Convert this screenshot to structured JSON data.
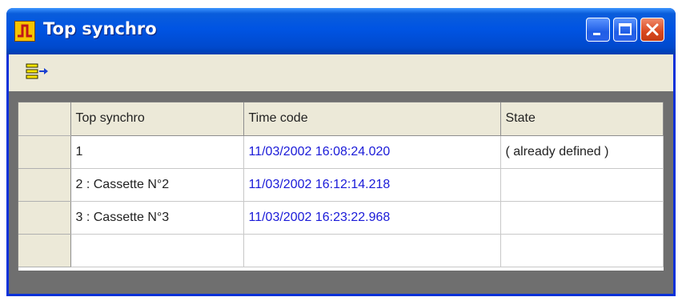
{
  "window": {
    "title": "Top synchro"
  },
  "toolbar": {
    "icons": [
      "export-icon"
    ]
  },
  "grid": {
    "columns": [
      "Top synchro",
      "Time code",
      "State"
    ],
    "rows": [
      {
        "top": "1",
        "timecode": "11/03/2002 16:08:24.020",
        "state": "( already defined )"
      },
      {
        "top": "2 : Cassette N°2",
        "timecode": "11/03/2002 16:12:14.218",
        "state": ""
      },
      {
        "top": "3 : Cassette N°3",
        "timecode": "11/03/2002 16:23:22.968",
        "state": ""
      },
      {
        "top": "",
        "timecode": "",
        "state": ""
      }
    ]
  },
  "colors": {
    "titlebar": "#0054e3",
    "timecode_text": "#1a1ad8",
    "client_background": "#6f6f6f",
    "toolbar_background": "#ece9d8"
  }
}
